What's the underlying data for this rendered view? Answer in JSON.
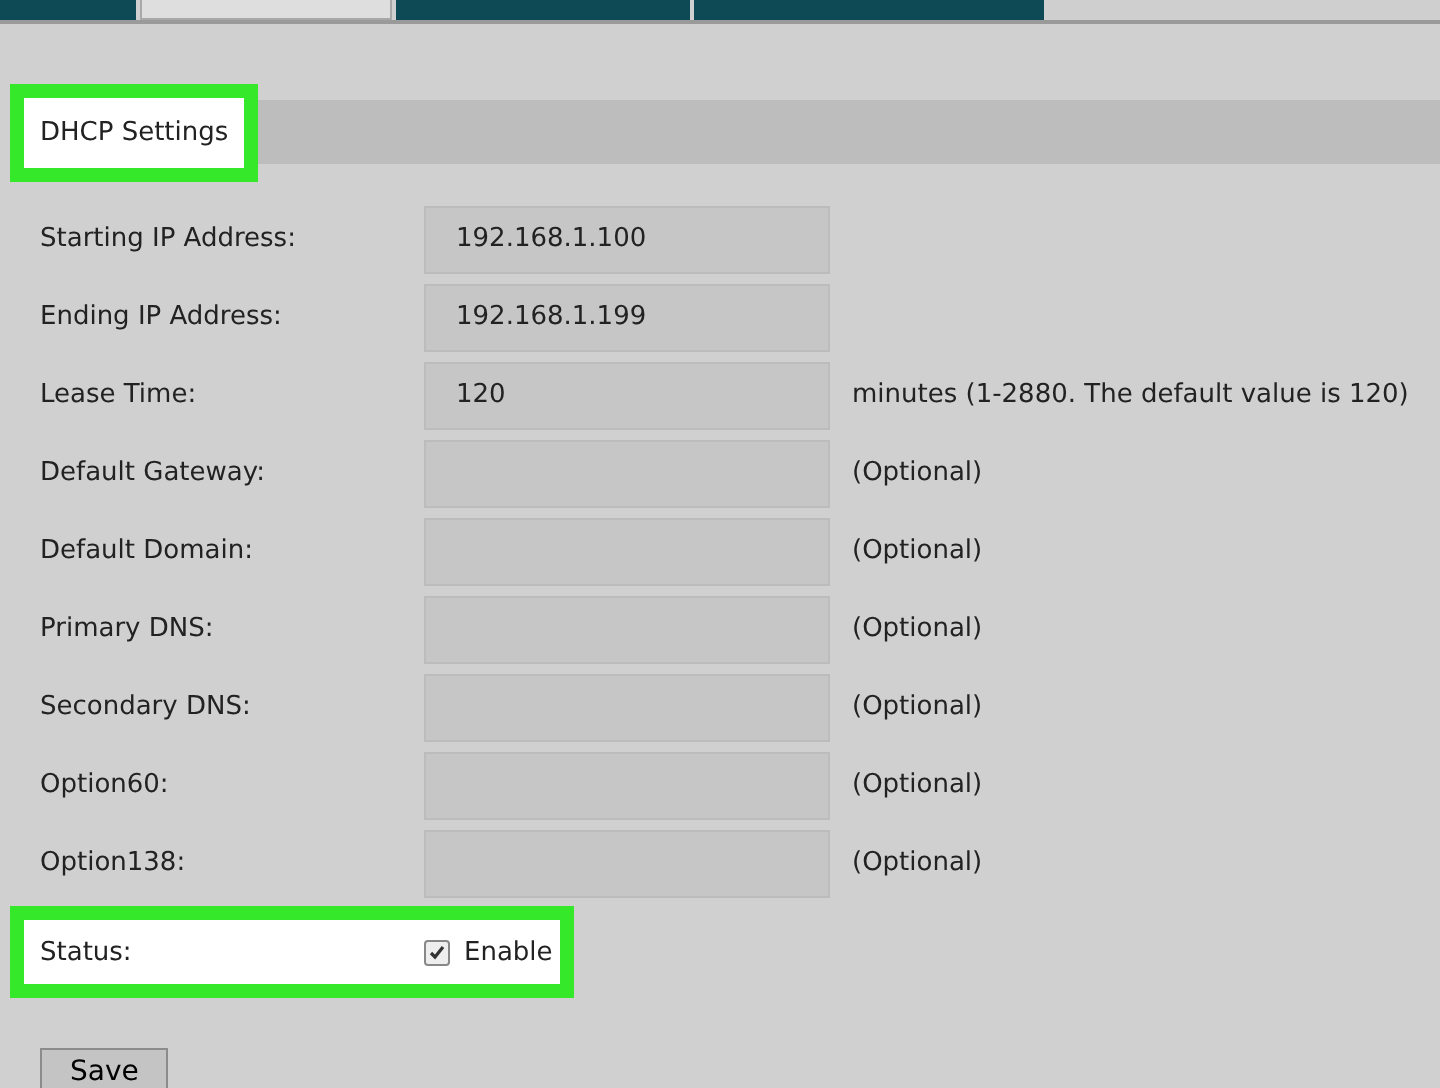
{
  "tabs": [
    {
      "selected": false
    },
    {
      "selected": true
    },
    {
      "selected": false
    },
    {
      "selected": false
    }
  ],
  "section": {
    "title": "DHCP Settings",
    "highlighted": true
  },
  "fields": [
    {
      "label": "Starting IP Address:",
      "value": "192.168.1.100"
    },
    {
      "label": "Ending IP Address:",
      "value": "192.168.1.199"
    },
    {
      "label": "Lease Time:",
      "value": "120",
      "note": "minutes (1-2880. The default value is 120)"
    },
    {
      "label": "Default Gateway:",
      "note": "(Optional)"
    },
    {
      "label": "Default Domain:",
      "note": "(Optional)"
    },
    {
      "label": "Primary DNS:",
      "note": "(Optional)"
    },
    {
      "label": "Secondary DNS:",
      "note": "(Optional)"
    },
    {
      "label": "Option60:",
      "note": "(Optional)"
    },
    {
      "label": "Option138:",
      "note": "(Optional)"
    }
  ],
  "status": {
    "label": "Status:",
    "option": "Enable",
    "checked": true,
    "highlighted": true
  },
  "buttons": [
    "Save"
  ]
}
